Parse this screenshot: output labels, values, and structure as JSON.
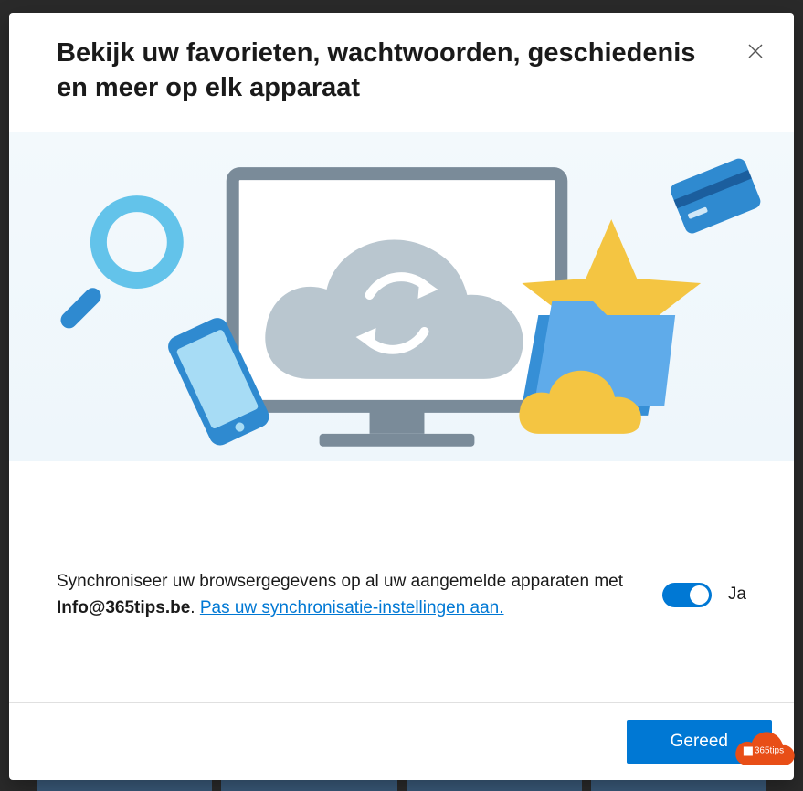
{
  "modal": {
    "title": "Bekijk uw favorieten, wachtwoorden, geschiedenis en meer op elk apparaat",
    "sync": {
      "text_before": "Synchroniseer uw browsergegevens op al uw aangemelde apparaten met ",
      "email": "Info@365tips.be",
      "text_after": ". ",
      "link_text": "Pas uw synchronisatie-instellingen aan."
    },
    "toggle": {
      "state": "on",
      "label": "Ja"
    },
    "done_button": "Gereed",
    "colors": {
      "primary": "#0078d4",
      "link": "#0078d4"
    }
  },
  "badge": {
    "label": "365tips"
  }
}
